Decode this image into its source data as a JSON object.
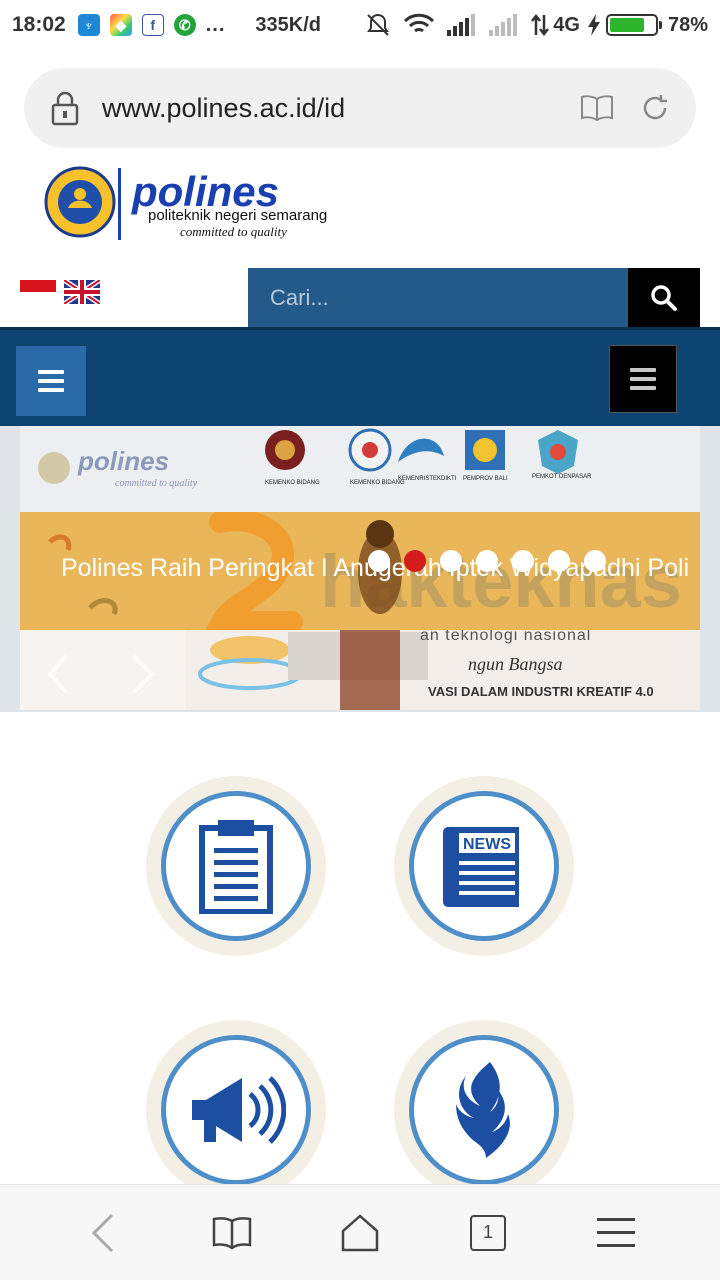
{
  "status_bar": {
    "time": "18:02",
    "more": "...",
    "speed": "335K/d",
    "network": "4G",
    "battery": "78%",
    "battery_level": 0.78,
    "apps": [
      {
        "name": "wifi-manager-app-icon",
        "glyph": "♆",
        "color": "#1f88d6"
      },
      {
        "name": "photo-app-icon",
        "glyph": "◆",
        "color": "#3fbf6a"
      },
      {
        "name": "facebook-icon",
        "glyph": "f",
        "color": "#3b5998"
      },
      {
        "name": "whatsapp-icon",
        "glyph": "✆",
        "color": "#25a33b"
      }
    ]
  },
  "browser": {
    "url": "www.polines.ac.id/id",
    "tab_count": "1"
  },
  "site": {
    "languages": [
      "id-flag-icon",
      "uk-flag-icon"
    ],
    "search": {
      "placeholder": "Cari..."
    },
    "slider": {
      "caption": "Polines Raih Peringkat I Anugerah Iptek Widyapadhi Poli",
      "dot_count": 7,
      "active_dot": 1
    },
    "tiles": [
      {
        "name": "clipboard-icon-tile",
        "icon": "clipboard-icon"
      },
      {
        "name": "news-icon-tile",
        "icon": "newspaper-icon"
      },
      {
        "name": "announcement-icon-tile",
        "icon": "megaphone-icon"
      },
      {
        "name": "flame-icon-tile",
        "icon": "flame-icon"
      }
    ]
  },
  "colors": {
    "search_bg": "#235a8a",
    "nav_bg": "#0e4471",
    "accent_blue": "#1c4fa1",
    "slide_band": "#e9b65a"
  }
}
